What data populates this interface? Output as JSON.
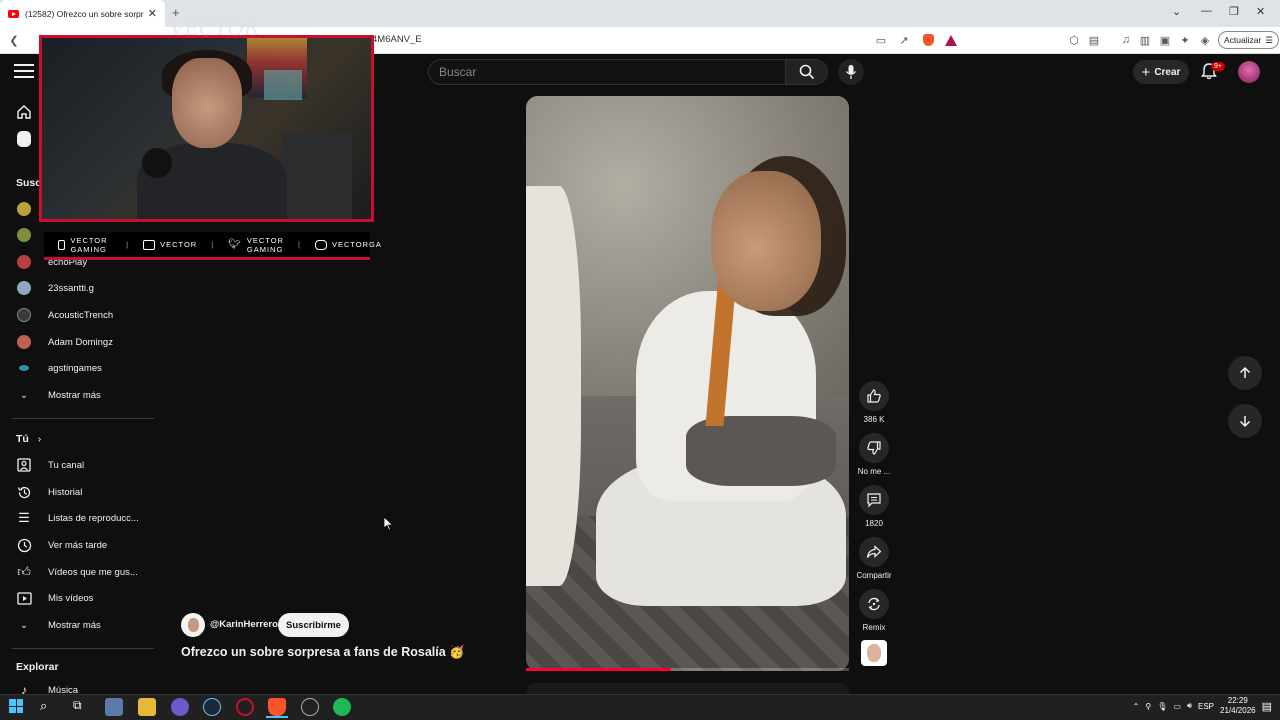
{
  "browser": {
    "tab_title": "(12582) Ofrezco un sobre sorpresa",
    "url": "4M6ANV_E",
    "update_label": "Actualizar"
  },
  "header": {
    "search_placeholder": "Buscar",
    "create_label": "Crear",
    "notif_badge": "9+"
  },
  "sidebar": {
    "subs_title": "Susc",
    "channels": [
      {
        "name": "",
        "color": "#b9a23a"
      },
      {
        "name": "",
        "color": "#7e8f3a"
      },
      {
        "name": "echoPlay",
        "color": "#b84040"
      },
      {
        "name": "23ssantti.g",
        "color": "#8fa5c0"
      },
      {
        "name": "AcousticTrench",
        "color": "#3b3b3b"
      },
      {
        "name": "Adam Domingz",
        "color": "#c06050"
      },
      {
        "name": "agstingames",
        "color": "#2e8fa8"
      }
    ],
    "show_more_1": "Mostrar más",
    "you_title": "Tú",
    "you_items": [
      "Tu canal",
      "Historial",
      "Listas de reproducc...",
      "Ver más tarde",
      "Vídeos que me gus...",
      "Mis vídeos"
    ],
    "show_more_2": "Mostrar más",
    "explore_title": "Explorar",
    "explore_items": [
      "Música"
    ]
  },
  "overlay": {
    "brand": "VECTOR",
    "social": [
      "VECTOR GAMING",
      "VECTOR",
      "VECTOR GAMING",
      "VECTORGA"
    ]
  },
  "video": {
    "progress": 0.45
  },
  "actions": {
    "likes": "386 K",
    "dislike_label": "No me ...",
    "comments": "1820",
    "share_label": "Compartir",
    "remix_label": "Remix"
  },
  "channel": {
    "handle": "@KarinHerrero",
    "subscribe_label": "Suscribirme",
    "title": "Ofrezco un sobre sorpresa a fans de Rosalía 🥳"
  },
  "taskbar": {
    "lang": "ESP",
    "time": "22:29",
    "date": "21/4/2026"
  }
}
